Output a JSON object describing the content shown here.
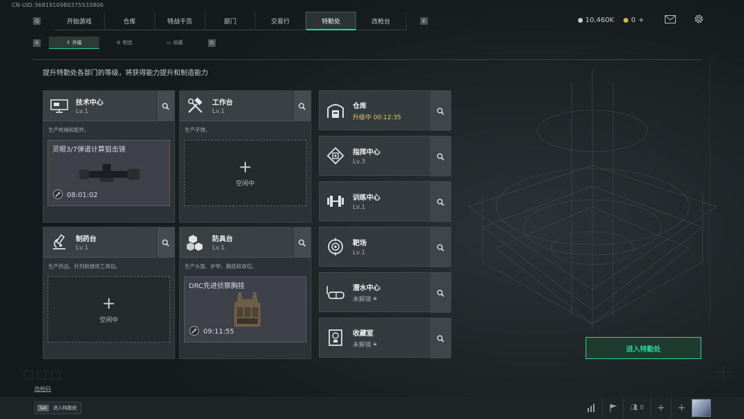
{
  "uid": "CN-UID:3681910980375533806",
  "nav": {
    "left_key": "Q",
    "right_key": "E",
    "tabs": [
      "开始游戏",
      "仓库",
      "特战干员",
      "部门",
      "交易行",
      "特勤处",
      "改枪台"
    ],
    "active": "特勤处"
  },
  "currency": {
    "coins": "10,460K",
    "coupons": "0",
    "plus": "+"
  },
  "subnav": {
    "left_key": "A",
    "right_key": "D",
    "tabs": [
      "升级",
      "制造",
      "收藏"
    ],
    "active": "升级"
  },
  "description": "提升特勤处各部门的等级，将获得能力提升和制造能力",
  "grid_cards": [
    {
      "title": "技术中心",
      "level": "Lv.1",
      "desc": "生产枪械和配件。",
      "slot": {
        "type": "item",
        "name": "灵眼3/7弹道计算狙击镜",
        "time": "08:01:02"
      }
    },
    {
      "title": "工作台",
      "level": "Lv.1",
      "desc": "生产子弹。",
      "slot": {
        "type": "idle",
        "label": "空闲中"
      }
    },
    {
      "title": "制药台",
      "level": "Lv.1",
      "desc": "生产药品、针剂和维修工具包。",
      "slot": {
        "type": "idle",
        "label": "空闲中"
      }
    },
    {
      "title": "防具台",
      "level": "Lv.1",
      "desc": "生产头盔、护甲、胸挂和背包。",
      "slot": {
        "type": "item",
        "name": "DRC先进侦察胸挂",
        "time": "09:11:55"
      }
    }
  ],
  "side_cards": [
    {
      "title": "仓库",
      "status": "升级中 00:12:35",
      "state": "upgrading"
    },
    {
      "title": "指挥中心",
      "status": "Lv.3",
      "state": "level"
    },
    {
      "title": "训练中心",
      "status": "Lv.1",
      "state": "level"
    },
    {
      "title": "靶场",
      "status": "Lv.1",
      "state": "level"
    },
    {
      "title": "潜水中心",
      "status": "未解锁",
      "state": "locked"
    },
    {
      "title": "收藏室",
      "status": "未解锁",
      "state": "locked"
    }
  ],
  "enter_button": "进入特勤处",
  "bottom_link": "改枪码",
  "bottom_key": {
    "key": "Tab",
    "label": "进入特勤处"
  },
  "friends_count": "0",
  "icons": {
    "mail": "mail-icon",
    "settings": "gear-icon",
    "search": "search-icon"
  },
  "colors": {
    "accent": "#2bd69a",
    "upgrading": "#e4c66a"
  }
}
